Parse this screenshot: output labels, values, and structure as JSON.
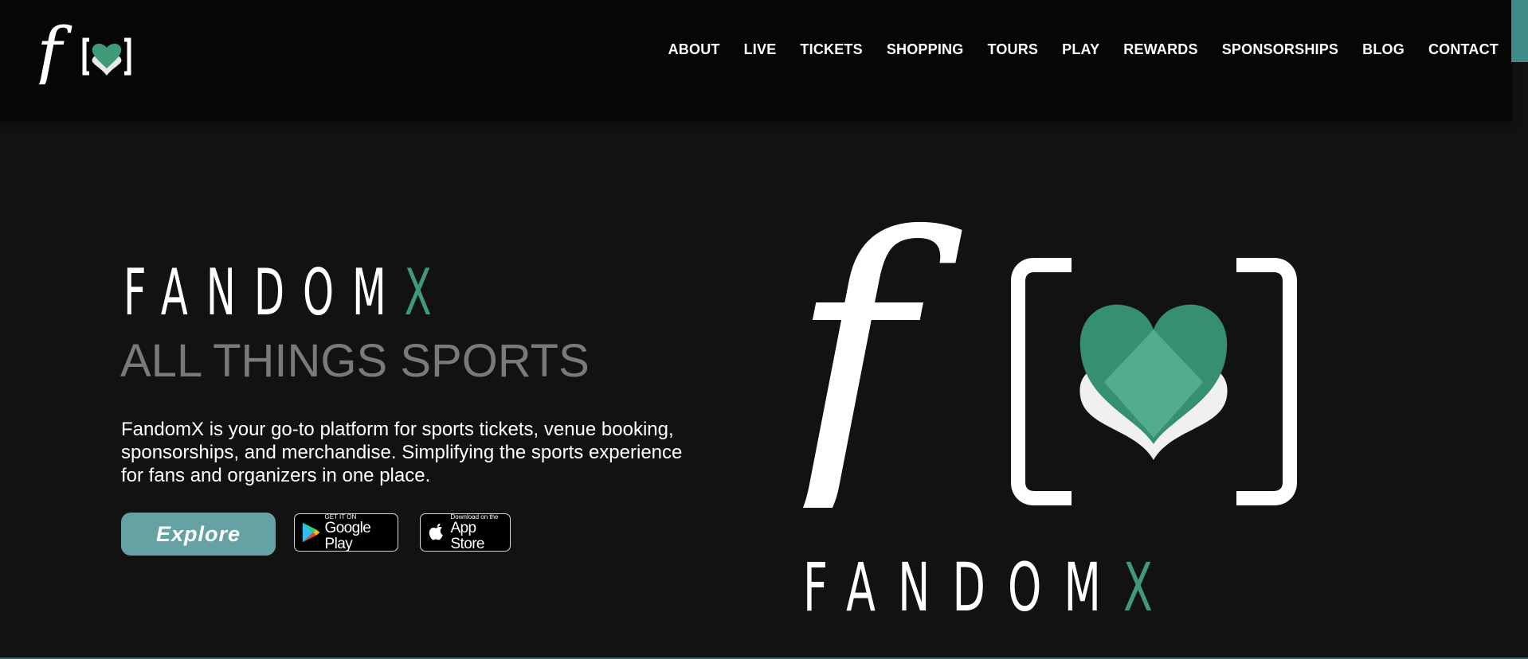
{
  "header": {
    "logo_text": "f",
    "nav": [
      "ABOUT",
      "LIVE",
      "TICKETS",
      "SHOPPING",
      "TOURS",
      "PLAY",
      "REWARDS",
      "SPONSORSHIPS",
      "BLOG",
      "CONTACT"
    ]
  },
  "hero": {
    "brand_main": "FANDOM",
    "brand_accent": "X",
    "tagline": "ALL THINGS SPORTS",
    "description": "FandomX is your go-to platform for sports tickets, venue booking, sponsorships, and merchandise. Simplifying the sports experience for fans and organizers in one place.",
    "explore_label": "Explore",
    "google_play": {
      "small": "GET IT ON",
      "big": "Google Play"
    },
    "app_store": {
      "small": "Download on the",
      "big": "App Store"
    }
  },
  "big_logo": {
    "letter": "f",
    "wordmark_main": "FANDOM",
    "wordmark_accent": "X"
  },
  "colors": {
    "background": "#121212",
    "header": "#060606",
    "accent_green": "#3f9a78",
    "heart_light": "#52ad8c",
    "explore_button": "#66a2a3",
    "tagline_gray": "#7a7a7a"
  }
}
